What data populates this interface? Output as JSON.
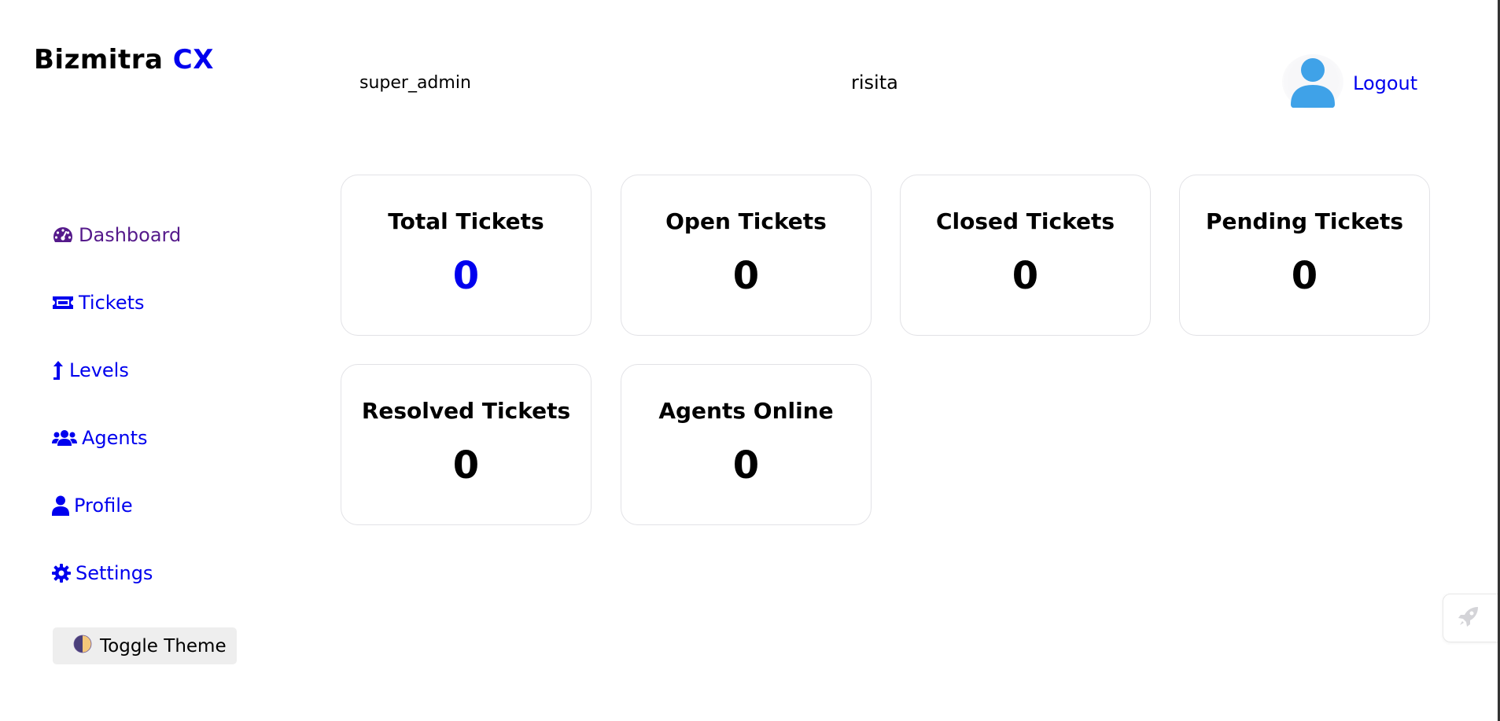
{
  "brand": {
    "name": "Bizmitra",
    "accent": "CX"
  },
  "header": {
    "role": "super_admin",
    "username": "risita",
    "logout_label": "Logout"
  },
  "sidebar": {
    "items": [
      {
        "label": "Dashboard",
        "icon": "gauge-icon",
        "active": true
      },
      {
        "label": "Tickets",
        "icon": "ticket-icon"
      },
      {
        "label": "Levels",
        "icon": "level-up-arrow-icon"
      },
      {
        "label": "Agents",
        "icon": "users-icon"
      },
      {
        "label": "Profile",
        "icon": "user-icon"
      },
      {
        "label": "Settings",
        "icon": "gear-icon"
      }
    ],
    "toggle_theme_label": "Toggle Theme",
    "toggle_theme_icon": "half-moon-icon"
  },
  "stats": [
    {
      "title": "Total Tickets",
      "value": "0"
    },
    {
      "title": "Open Tickets",
      "value": "0"
    },
    {
      "title": "Closed Tickets",
      "value": "0"
    },
    {
      "title": "Pending Tickets",
      "value": "0"
    },
    {
      "title": "Resolved Tickets",
      "value": "0"
    },
    {
      "title": "Agents Online",
      "value": "0"
    }
  ],
  "launcher": {
    "icon": "rocket-icon"
  },
  "colors": {
    "link": "#0000ee",
    "active_link": "#551a8b",
    "avatar": "#3fa2e8",
    "card_border": "#e2e2e6"
  }
}
